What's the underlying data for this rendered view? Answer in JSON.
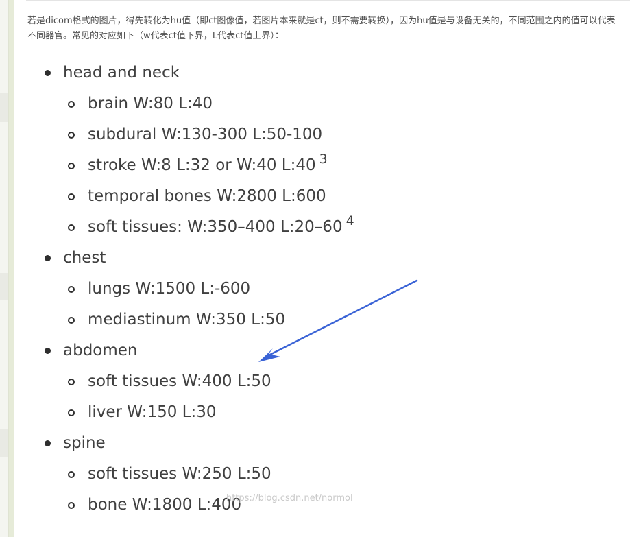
{
  "intro_text": "若是dicom格式的图片，得先转化为hu值（即ct图像值，若图片本来就是ct，则不需要转换），因为hu值是与设备无关的，不同范围之内的值可以代表不同器官。常见的对应如下（w代表ct值下界，L代表ct值上界）：",
  "categories": [
    {
      "label": "head and neck",
      "items": [
        {
          "text": "brain W:80 L:40",
          "sup": ""
        },
        {
          "text": "subdural W:130-300 L:50-100",
          "sup": ""
        },
        {
          "text": "stroke W:8 L:32 or W:40 L:40",
          "sup": "3"
        },
        {
          "text": "temporal bones W:2800 L:600",
          "sup": ""
        },
        {
          "text": "soft tissues: W:350–400 L:20–60",
          "sup": "4"
        }
      ]
    },
    {
      "label": "chest",
      "items": [
        {
          "text": "lungs W:1500 L:-600",
          "sup": ""
        },
        {
          "text": "mediastinum W:350 L:50",
          "sup": ""
        }
      ]
    },
    {
      "label": "abdomen",
      "items": [
        {
          "text": "soft tissues W:400 L:50",
          "sup": ""
        },
        {
          "text": "liver W:150 L:30",
          "sup": ""
        }
      ]
    },
    {
      "label": "spine",
      "items": [
        {
          "text": "soft tissues W:250 L:50",
          "sup": ""
        },
        {
          "text": "bone W:1800 L:400",
          "sup": ""
        }
      ]
    }
  ],
  "watermark": "https://blog.csdn.net/normol",
  "colors": {
    "arrow": "#3a63d6",
    "text": "#404040",
    "intro_text": "#4f4f4f"
  }
}
